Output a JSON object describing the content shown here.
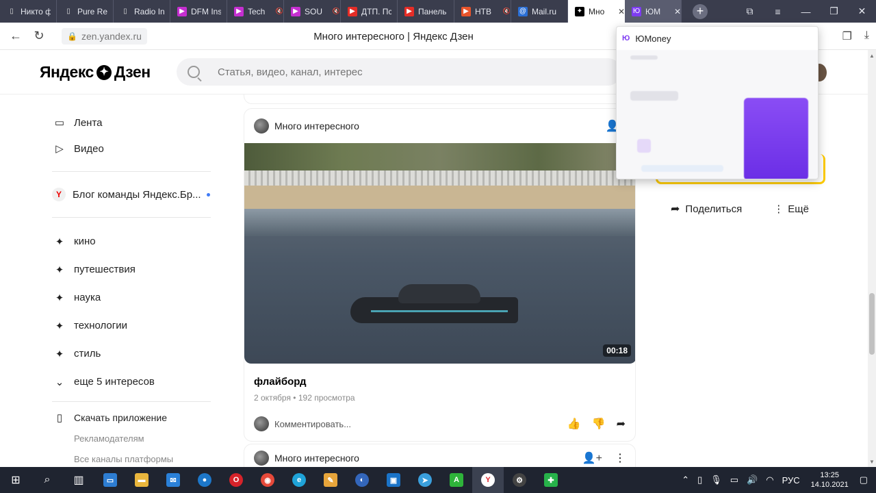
{
  "tabs": [
    {
      "title": "Никто ф",
      "icon": "page-icon",
      "muted": false
    },
    {
      "title": "Pure Re",
      "icon": "page-icon",
      "muted": false
    },
    {
      "title": "Radio In",
      "icon": "page-icon",
      "muted": false
    },
    {
      "title": "DFM Ins",
      "icon": "play-icon",
      "muted": false
    },
    {
      "title": "Tech",
      "icon": "play-icon",
      "muted": true
    },
    {
      "title": "SOU",
      "icon": "play-icon",
      "muted": true
    },
    {
      "title": "ДТП. Пс",
      "icon": "youtube-icon",
      "muted": false
    },
    {
      "title": "Панель",
      "icon": "youtube-icon",
      "muted": false
    },
    {
      "title": "НТВ",
      "icon": "ntv-icon",
      "muted": true
    },
    {
      "title": "Mail.ru",
      "icon": "mail-icon",
      "muted": false
    },
    {
      "title": "Мно",
      "icon": "zen-icon",
      "muted": false,
      "active": true
    },
    {
      "title": "ЮМ",
      "icon": "yumoney-icon",
      "muted": false
    }
  ],
  "address": {
    "url": "zen.yandex.ru",
    "page_title": "Много интересного | Яндекс Дзен"
  },
  "header": {
    "logo_left": "Яндекс",
    "logo_right": "Дзен",
    "search_placeholder": "Статья, видео, канал, интерес"
  },
  "sidebar": {
    "nav": [
      {
        "label": "Лента",
        "icon": "laptop-icon"
      },
      {
        "label": "Видео",
        "icon": "play-outline-icon"
      }
    ],
    "blog": {
      "label": "Блог команды Яндекс.Бр...",
      "badge": "Y"
    },
    "interests": [
      "кино",
      "путешествия",
      "наука",
      "технологии",
      "стиль"
    ],
    "more_interests": "еще 5 интересов",
    "app": "Скачать приложение",
    "advertisers": "Рекламодателям",
    "channels": "Все каналы платформы"
  },
  "card": {
    "channel": "Много интересного",
    "duration": "00:18",
    "title": "флайборд",
    "meta": "2 октября • 192 просмотра",
    "comment": "Комментировать..."
  },
  "card2": {
    "channel": "Много интересного"
  },
  "rightpanel": {
    "share": "Поделиться",
    "more": "Ещё"
  },
  "popup": {
    "title": "ЮMoney",
    "logo": "Ю"
  },
  "taskbar": {
    "lang": "РУС",
    "time": "13:25",
    "date": "14.10.2021"
  },
  "colors": {
    "accent": "#3f7bf6",
    "popup_purple": "#7e3cf2",
    "highlight": "#ffcc00"
  }
}
